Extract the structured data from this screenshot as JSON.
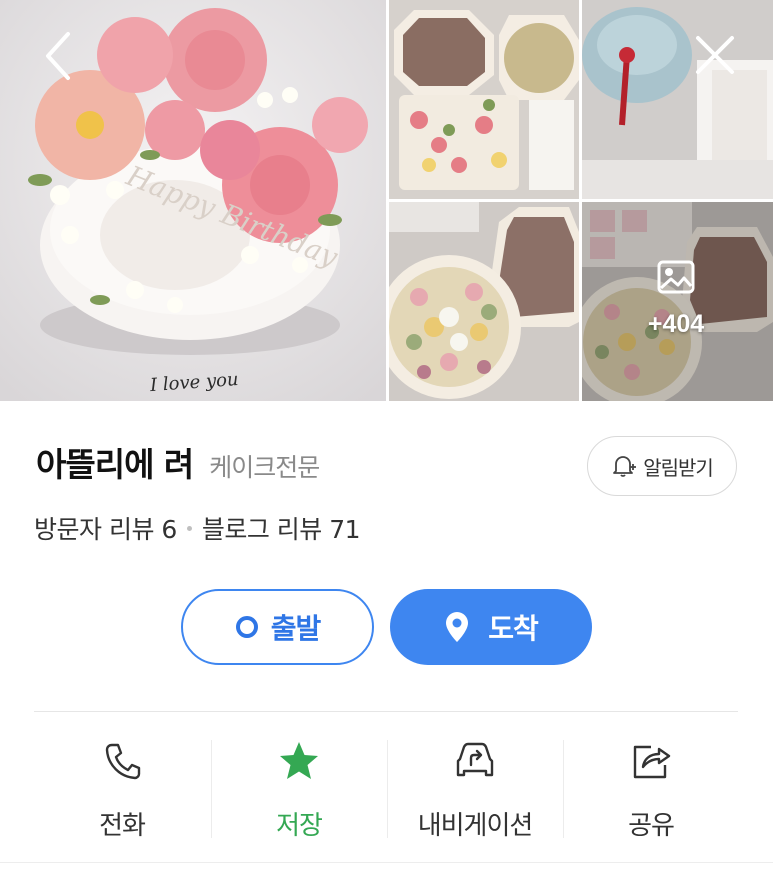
{
  "gallery": {
    "photos": [
      {
        "name": "main-photo",
        "caption_text": "Happy Birthday",
        "caption_script": "I love you"
      },
      {
        "name": "photo-tteok-boxes"
      },
      {
        "name": "photo-wrapped-gift"
      },
      {
        "name": "photo-rice-cake-flowers"
      },
      {
        "name": "photo-rice-cake-set"
      }
    ],
    "more_count": "+404",
    "back_icon": "chevron-left-icon",
    "close_icon": "close-icon",
    "more_icon": "image-icon"
  },
  "place": {
    "name": "아뜰리에 려",
    "category": "케이크전문",
    "notify_label": "알림받기",
    "visitor_review": "방문자 리뷰 6",
    "blog_review": "블로그 리뷰 71"
  },
  "route": {
    "start_label": "출발",
    "destination_label": "도착"
  },
  "actions": [
    {
      "label": "전화",
      "icon": "phone-icon"
    },
    {
      "label": "저장",
      "icon": "star-icon"
    },
    {
      "label": "내비게이션",
      "icon": "car-navigation-icon"
    },
    {
      "label": "공유",
      "icon": "share-icon"
    }
  ],
  "colors": {
    "primary_blue": "#3e86f0",
    "save_green": "#34a853",
    "category_gray": "#8a8a8a"
  }
}
